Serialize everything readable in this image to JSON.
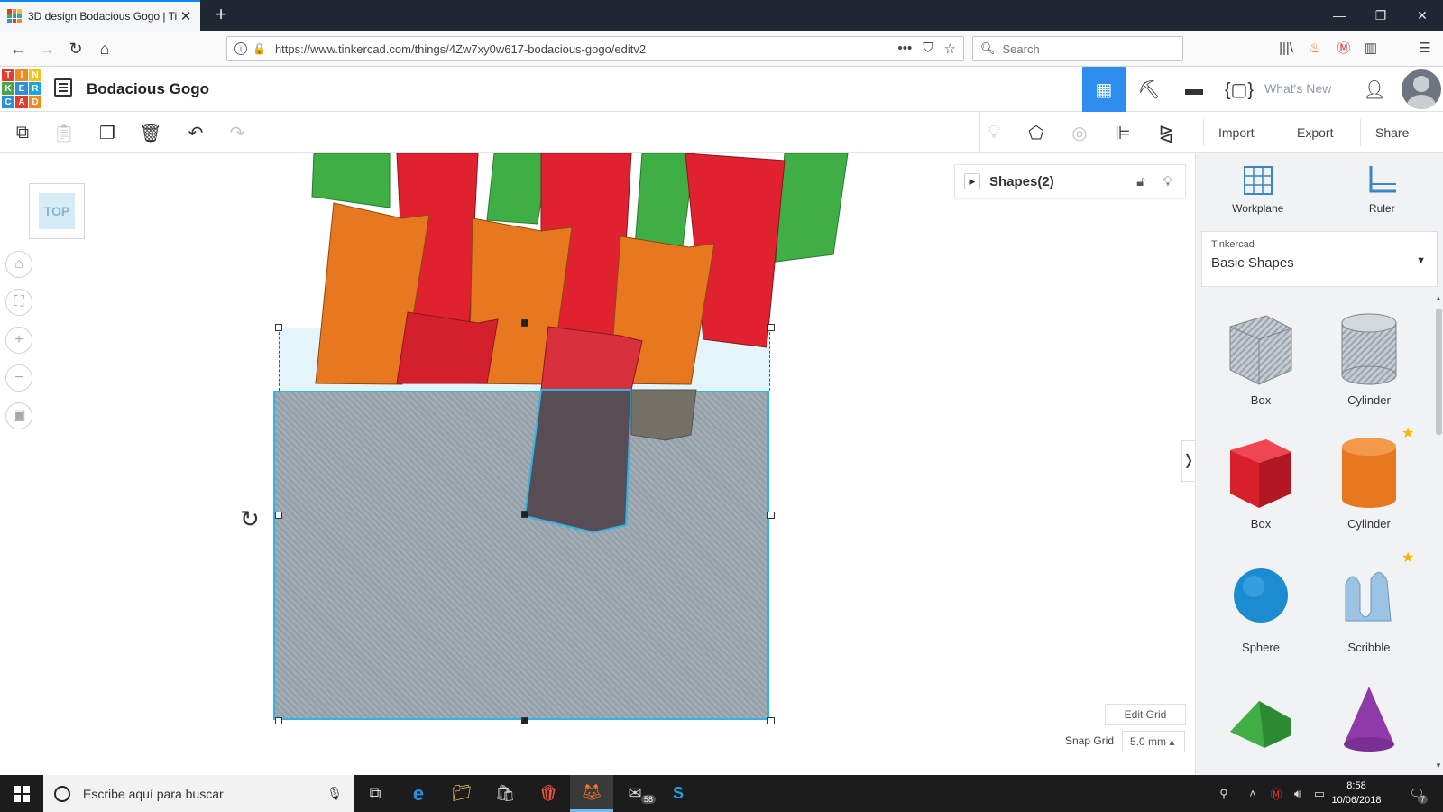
{
  "browser": {
    "tab_title": "3D design Bodacious Gogo | Ti",
    "tab_close": "✕",
    "new_tab": "+",
    "url": "https://www.tinkercad.com/things/4Zw7xy0w617-bodacious-gogo/editv2",
    "search_placeholder": "Search",
    "url_dots": "•••"
  },
  "app": {
    "logo_letters": [
      "T",
      "I",
      "N",
      "K",
      "E",
      "R",
      "C",
      "A",
      "D"
    ],
    "logo_colors": [
      "#e53b2c",
      "#f08b1d",
      "#f5c41a",
      "#4ba54c",
      "#2c92d6",
      "#1fa5d8",
      "#2c92d6",
      "#e53b2c",
      "#f08b1d"
    ],
    "design_title": "Bodacious Gogo",
    "whats_new": "What's New"
  },
  "toolbar": {
    "import": "Import",
    "export": "Export",
    "share": "Share"
  },
  "viewport": {
    "viewcube_label": "TOP",
    "shapes_panel_title": "Shapes(2)",
    "edit_grid": "Edit Grid",
    "snap_grid_label": "Snap Grid",
    "snap_grid_value": "5.0 mm ▴",
    "colors": {
      "green": "#3fae45",
      "red": "#e0212f",
      "orange": "#e8781f",
      "selection": "#2bb6e6"
    }
  },
  "right_panel": {
    "workplane": "Workplane",
    "ruler": "Ruler",
    "library_category": "Tinkercad",
    "library_value": "Basic Shapes",
    "shapes": [
      {
        "name": "Box"
      },
      {
        "name": "Cylinder"
      },
      {
        "name": "Box"
      },
      {
        "name": "Cylinder"
      },
      {
        "name": "Sphere"
      },
      {
        "name": "Scribble"
      }
    ]
  },
  "taskbar": {
    "search_text": "Escribe aquí para buscar",
    "mail_badge": "58",
    "time": "8:58",
    "date": "10/06/2018",
    "notif_count": "7"
  }
}
